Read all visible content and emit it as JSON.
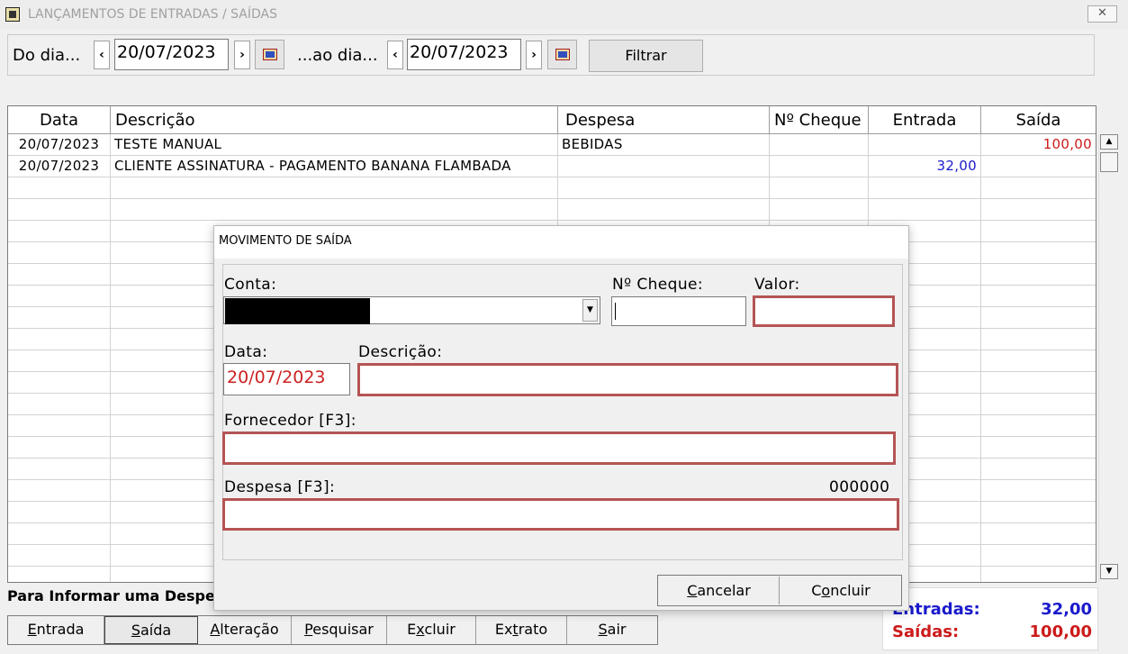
{
  "window": {
    "title": "LANÇAMENTOS DE ENTRADAS / SAÍDAS",
    "close_symbol": "✕"
  },
  "filter": {
    "from_label": "Do dia...",
    "to_label": "...ao dia...",
    "from_date": "20/07/2023",
    "to_date": "20/07/2023",
    "prev_symbol": "‹",
    "next_symbol": "›",
    "filter_button": "Filtrar"
  },
  "grid": {
    "columns": [
      "Data",
      "Descrição",
      "Despesa",
      "Nº Cheque",
      "Entrada",
      "Saída"
    ],
    "rows": [
      [
        "20/07/2023",
        "TESTE MANUAL",
        "BEBIDAS",
        "",
        "",
        "100,00"
      ],
      [
        "20/07/2023",
        "CLIENTE ASSINATURA - PAGAMENTO BANANA FLAMBADA",
        "",
        "",
        "32,00",
        ""
      ]
    ],
    "colors": {
      "entrada": "#1a1acc",
      "saida": "#cc1a1a"
    }
  },
  "info_text": "Para Informar uma Despe",
  "toolbar": {
    "entrada": {
      "pre": "",
      "key": "E",
      "post": "ntrada"
    },
    "saida": {
      "pre": "",
      "key": "S",
      "post": "aída"
    },
    "alteracao": {
      "pre": "",
      "key": "A",
      "post": "lteração"
    },
    "pesquisar": {
      "pre": "",
      "key": "P",
      "post": "esquisar"
    },
    "excluir": {
      "pre": "E",
      "key": "x",
      "post": "cluir"
    },
    "extrato": {
      "pre": "Ex",
      "key": "t",
      "post": "rato"
    },
    "sair": {
      "pre": "",
      "key": "S",
      "post": "air"
    }
  },
  "totals": {
    "entradas_label": "Entradas:",
    "entradas_value": "32,00",
    "saidas_label": "Saídas:",
    "saidas_value": "100,00"
  },
  "dialog": {
    "title": "MOVIMENTO DE SAÍDA",
    "conta_label": "Conta:",
    "cheque_label": "Nº Cheque:",
    "valor_label": "Valor:",
    "data_label": "Data:",
    "data_value": "20/07/2023",
    "descricao_label": "Descrição:",
    "fornecedor_label": "Fornecedor [F3]:",
    "despesa_label": "Despesa [F3]:",
    "despesa_code": "000000",
    "cancel": {
      "pre": "",
      "key": "C",
      "post": "ancelar"
    },
    "conclude": {
      "pre": "C",
      "key": "o",
      "post": "ncluir"
    },
    "required_color": "#b55454"
  }
}
